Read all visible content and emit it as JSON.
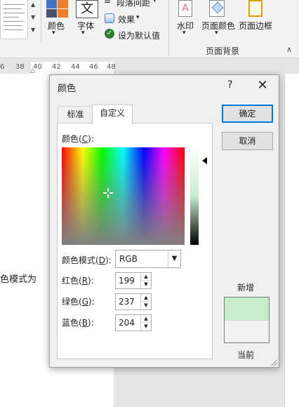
{
  "ribbon": {
    "color_label": "颜色",
    "font_label": "字体",
    "font_glyph": "文",
    "paragraph_spacing": "段落间距",
    "effects": "效果",
    "set_default": "设为默认值",
    "watermark": "水印",
    "page_color": "页面颜色",
    "page_border": "页面边框",
    "group_label": "页面背景"
  },
  "ruler": {
    "ticks": [
      "6",
      "38",
      "40",
      "42",
      "44",
      "46",
      "48"
    ]
  },
  "document": {
    "fragment": "色模式为"
  },
  "dialog": {
    "title": "颜色",
    "help": "?",
    "close": "✕",
    "tabs": {
      "standard": "标准",
      "custom": "自定义"
    },
    "colors_label": {
      "text": "颜色(",
      "key": "C",
      "end": "):"
    },
    "model_label": {
      "text": "颜色模式(",
      "key": "D",
      "end": "):"
    },
    "model_value": "RGB",
    "red_label": {
      "text": "红色(",
      "key": "R",
      "end": "):"
    },
    "green_label": {
      "text": "绿色(",
      "key": "G",
      "end": "):"
    },
    "blue_label": {
      "text": "蓝色(",
      "key": "B",
      "end": "):"
    },
    "red": "199",
    "green": "237",
    "blue": "204",
    "ok": "确定",
    "cancel": "取消",
    "new_label": "新增",
    "current_label": "当前",
    "new_color": "#c7edcc",
    "current_color": "#f2f2f2"
  }
}
